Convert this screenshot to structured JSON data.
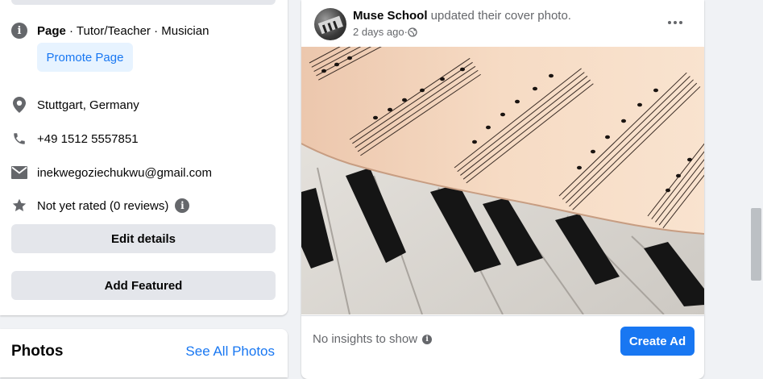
{
  "intro": {
    "page_label": "Page",
    "page_category": " · Tutor/Teacher · Musician",
    "promote_label": "Promote Page",
    "location": "Stuttgart, Germany",
    "phone": "+49 1512 5557851",
    "email": "inekwegoziechukwu@gmail.com",
    "rating": "Not yet rated (0 reviews)",
    "edit_label": "Edit details",
    "featured_label": "Add Featured"
  },
  "photos": {
    "title": "Photos",
    "see_all": "See All Photos"
  },
  "post": {
    "author": "Muse School",
    "action": " updated their cover photo.",
    "time": "2 days ago",
    "separator": " · ",
    "insights": "No insights to show",
    "create_ad_label": "Create Ad"
  },
  "colors": {
    "accent": "#1877f2",
    "accent_light": "#e7f3ff",
    "button_grey": "#e4e6eb",
    "text_secondary": "#65676b",
    "background": "#f0f2f5"
  },
  "icons": {
    "info": "info-icon",
    "location": "location-pin-icon",
    "phone": "phone-icon",
    "email": "envelope-icon",
    "rating": "star-icon",
    "audience": "globe-icon",
    "more": "more-dots-icon"
  }
}
